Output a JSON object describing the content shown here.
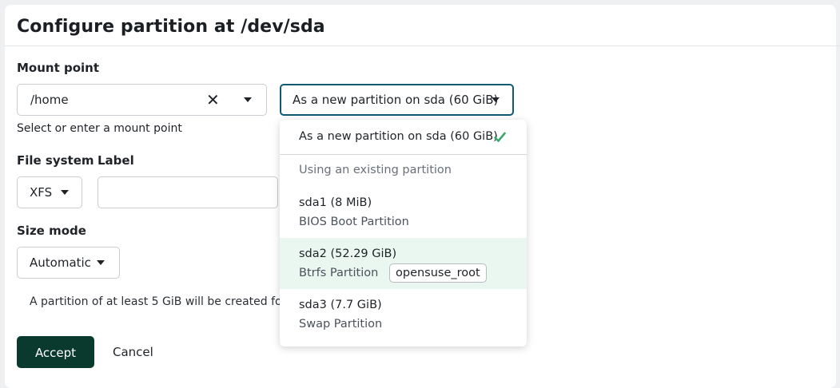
{
  "dialog": {
    "title": "Configure partition at /dev/sda"
  },
  "mount_point": {
    "label": "Mount point",
    "value": "/home",
    "helper": "Select or enter a mount point"
  },
  "target": {
    "selected": "As a new partition on sda (60 GiB)"
  },
  "file_system": {
    "label": "File system",
    "value": "XFS"
  },
  "label_field": {
    "label": "Label",
    "value": ""
  },
  "size_mode": {
    "label": "Size mode",
    "value": "Automatic",
    "info": "A partition of at least 5 GiB will be created fo"
  },
  "dropdown": {
    "selected_option": "As a new partition on sda (60 GiB)",
    "group_label": "Using an existing partition",
    "options": [
      {
        "name": "sda1 (8 MiB)",
        "desc": "BIOS Boot Partition",
        "tag": ""
      },
      {
        "name": "sda2 (52.29 GiB)",
        "desc": "Btrfs Partition",
        "tag": "opensuse_root"
      },
      {
        "name": "sda3 (7.7 GiB)",
        "desc": "Swap Partition",
        "tag": ""
      }
    ]
  },
  "actions": {
    "accept": "Accept",
    "cancel": "Cancel"
  },
  "colors": {
    "accent": "#0e5a73",
    "primary_button": "#0a3a2e",
    "check": "#3aa86b",
    "highlight": "#eaf7f1"
  }
}
